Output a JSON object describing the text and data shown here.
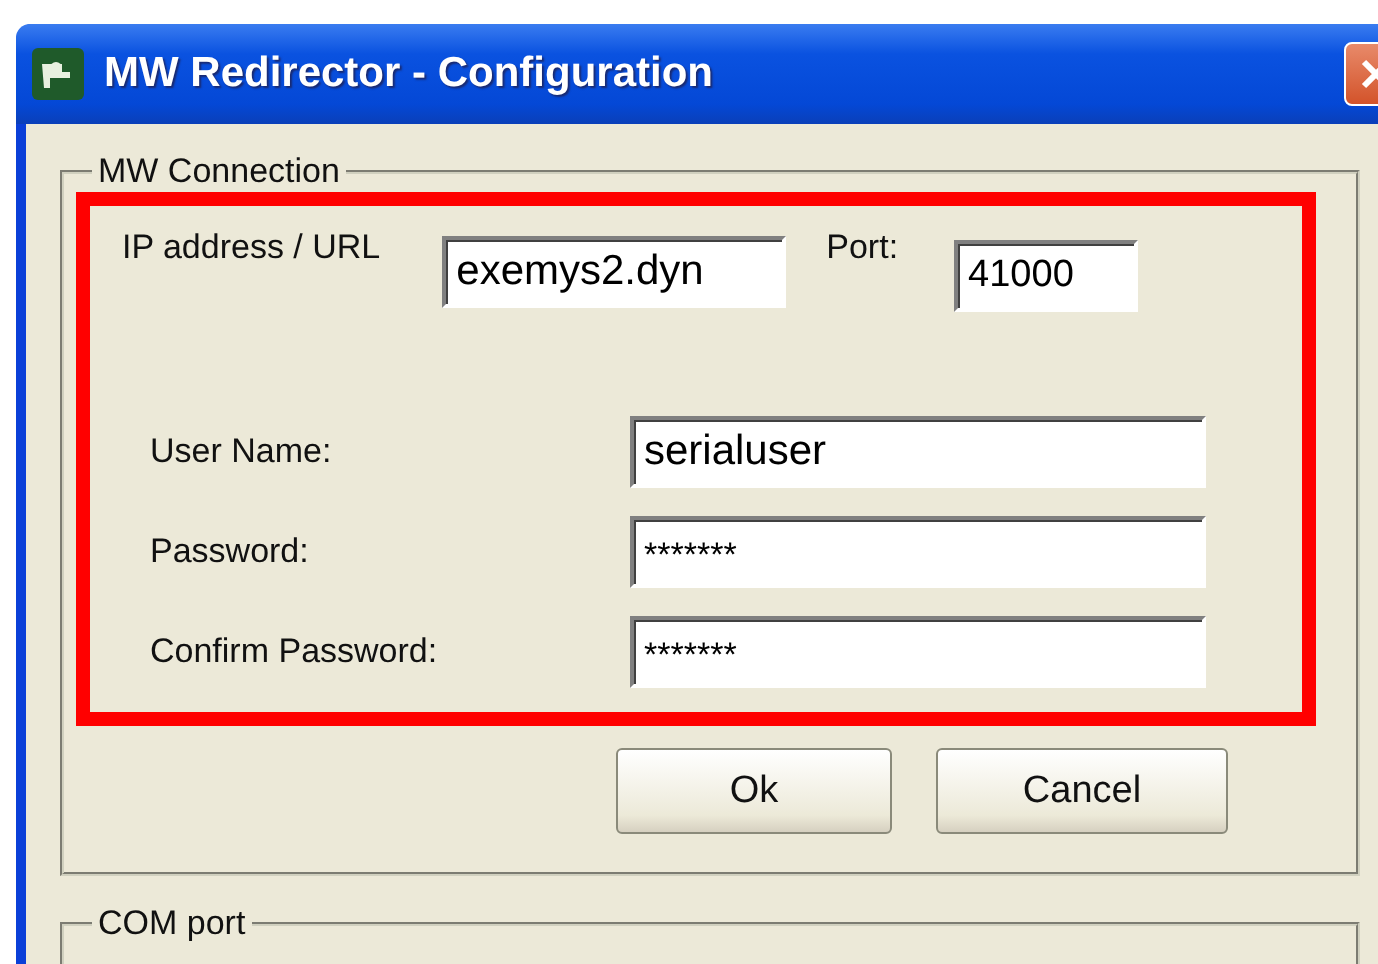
{
  "window": {
    "title": "MW Redirector - Configuration"
  },
  "mw_connection": {
    "title": "MW Connection",
    "ip": {
      "label": "IP address / URL",
      "value": "exemys2.dyn"
    },
    "port": {
      "label": "Port:",
      "value": "41000"
    },
    "fields": [
      {
        "label": "User Name:",
        "value": "serialuser",
        "kind": "text"
      },
      {
        "label": "Password:",
        "value": "*******",
        "kind": "password"
      },
      {
        "label": "Confirm Password:",
        "value": "*******",
        "kind": "password"
      }
    ],
    "buttons": [
      "Ok",
      "Cancel"
    ]
  },
  "com_port": {
    "title": "COM port"
  }
}
